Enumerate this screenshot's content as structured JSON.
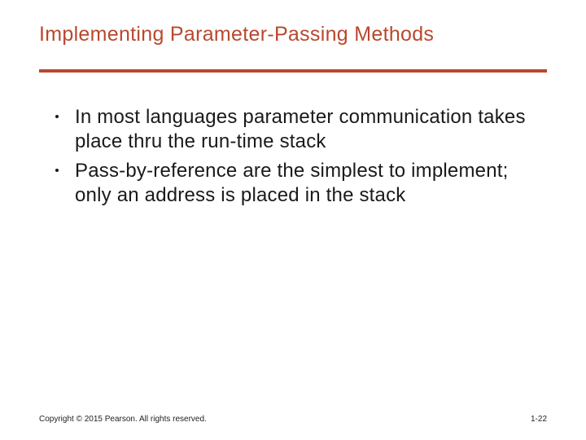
{
  "slide": {
    "title": "Implementing Parameter-Passing Methods",
    "bullets": [
      "In most languages parameter communication takes place thru the run-time stack",
      "Pass-by-reference are the simplest to implement; only an address is placed in the stack"
    ]
  },
  "footer": {
    "copyright": "Copyright © 2015 Pearson. All rights reserved.",
    "page": "1-22"
  }
}
